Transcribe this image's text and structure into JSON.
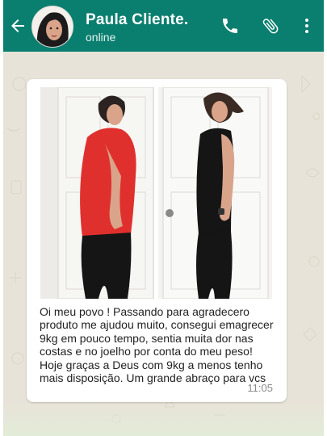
{
  "header": {
    "contact_name": "Paula Cliente.",
    "status": "online",
    "color": "#0a7e6f",
    "icons": [
      "back-arrow-icon",
      "phone-icon",
      "paperclip-icon",
      "more-vert-icon"
    ]
  },
  "message": {
    "caption": "Oi meu povo ! Passando para agradecero produto me ajudou muito, consegui emagrecer 9kg em pouco tempo, sentia muita dor nas costas e no joelho por conta do meu peso! Hoje graças a Deus com 9kg a menos tenho mais disposição. Um grande abraço para vcs",
    "time": "11:05"
  }
}
